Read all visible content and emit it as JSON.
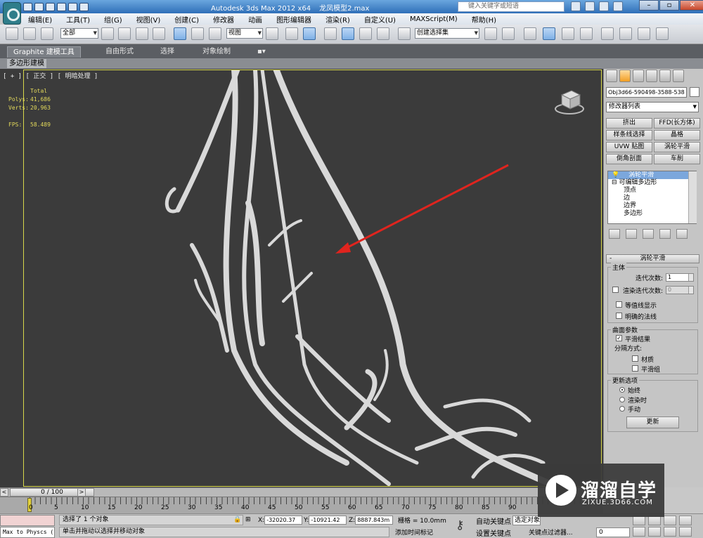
{
  "title": {
    "app": "Autodesk 3ds Max  2012 x64",
    "file": "龙凤模型2.max",
    "search_placeholder": "键入关键字或短语"
  },
  "menu": [
    "编辑(E)",
    "工具(T)",
    "组(G)",
    "视图(V)",
    "创建(C)",
    "修改器",
    "动画",
    "图形编辑器",
    "渲染(R)",
    "自定义(U)",
    "MAXScript(M)",
    "帮助(H)"
  ],
  "toolbar": {
    "selection_filter": "全部",
    "reference_coord": "视图",
    "named_selection": "创建选择集"
  },
  "ribbon": {
    "tabs": [
      "Graphite 建模工具",
      "自由形式",
      "选择",
      "对象绘制"
    ],
    "sub_label": "多边形建模"
  },
  "viewport": {
    "label": "[ + ] [ 正交 ] [ 明暗处理 ]",
    "stats": {
      "header": "Total",
      "polys_label": "Polys:",
      "polys": "41,686",
      "verts_label": "Verts:",
      "verts": "20,963",
      "fps_label": "FPS:",
      "fps": "58.489"
    },
    "background_color": "#3b3b3b",
    "frame_color": "#d8d84b",
    "arrow_color": "#e0241e"
  },
  "command_panel": {
    "object_name": "Obj3d66-590498-3588-538",
    "modifier_list": "修改器列表",
    "modifier_buttons": [
      "挤出",
      "FFD(长方体)",
      "样条线选择",
      "晶格",
      "UVW 贴图",
      "涡轮平滑",
      "倒角剖面",
      "车削"
    ],
    "stack": {
      "top": "涡轮平滑",
      "base": "可编辑多边形",
      "subs": [
        "顶点",
        "边",
        "边界",
        "多边形"
      ]
    },
    "rollout": {
      "title": "涡轮平滑",
      "main_group": "主体",
      "iterations_label": "迭代次数:",
      "iterations": "1",
      "render_iters_label": "渲染迭代次数:",
      "render_iters": "0",
      "isoline": "等值线显示",
      "explicit_normals": "明确的法线",
      "surface_group": "曲面参数",
      "smooth_result": "平滑结果",
      "separate_by": "分隔方式:",
      "materials": "材质",
      "smoothing_groups": "平滑组",
      "update_group": "更新选项",
      "always": "始终",
      "when_rendering": "渲染时",
      "manually": "手动",
      "update_btn": "更新"
    }
  },
  "timeline": {
    "slider": "0 / 100",
    "ticks": [
      "0",
      "5",
      "10",
      "15",
      "20",
      "25",
      "30",
      "35",
      "40",
      "45",
      "50",
      "55",
      "60",
      "65",
      "70",
      "75",
      "80",
      "85",
      "90"
    ]
  },
  "status": {
    "maxscript": "Max to Physcs (",
    "selected": "选择了 1 个对象",
    "prompt": "单击并拖动以选择并移动对象",
    "x_label": "X:",
    "x": "-32020.37",
    "y_label": "Y:",
    "y": "-10921.42",
    "z_label": "Z:",
    "z": "8887.843m",
    "grid": "栅格 = 10.0mm",
    "add_time_tag": "添加时间标记",
    "auto_key": "自动关键点",
    "set_key": "设置关键点",
    "selected_drop": "选定对象",
    "key_filters": "关键点过滤器...",
    "frame": "0"
  },
  "watermark": {
    "title": "溜溜自学",
    "sub": "ZIXUE.3D66.COM"
  }
}
